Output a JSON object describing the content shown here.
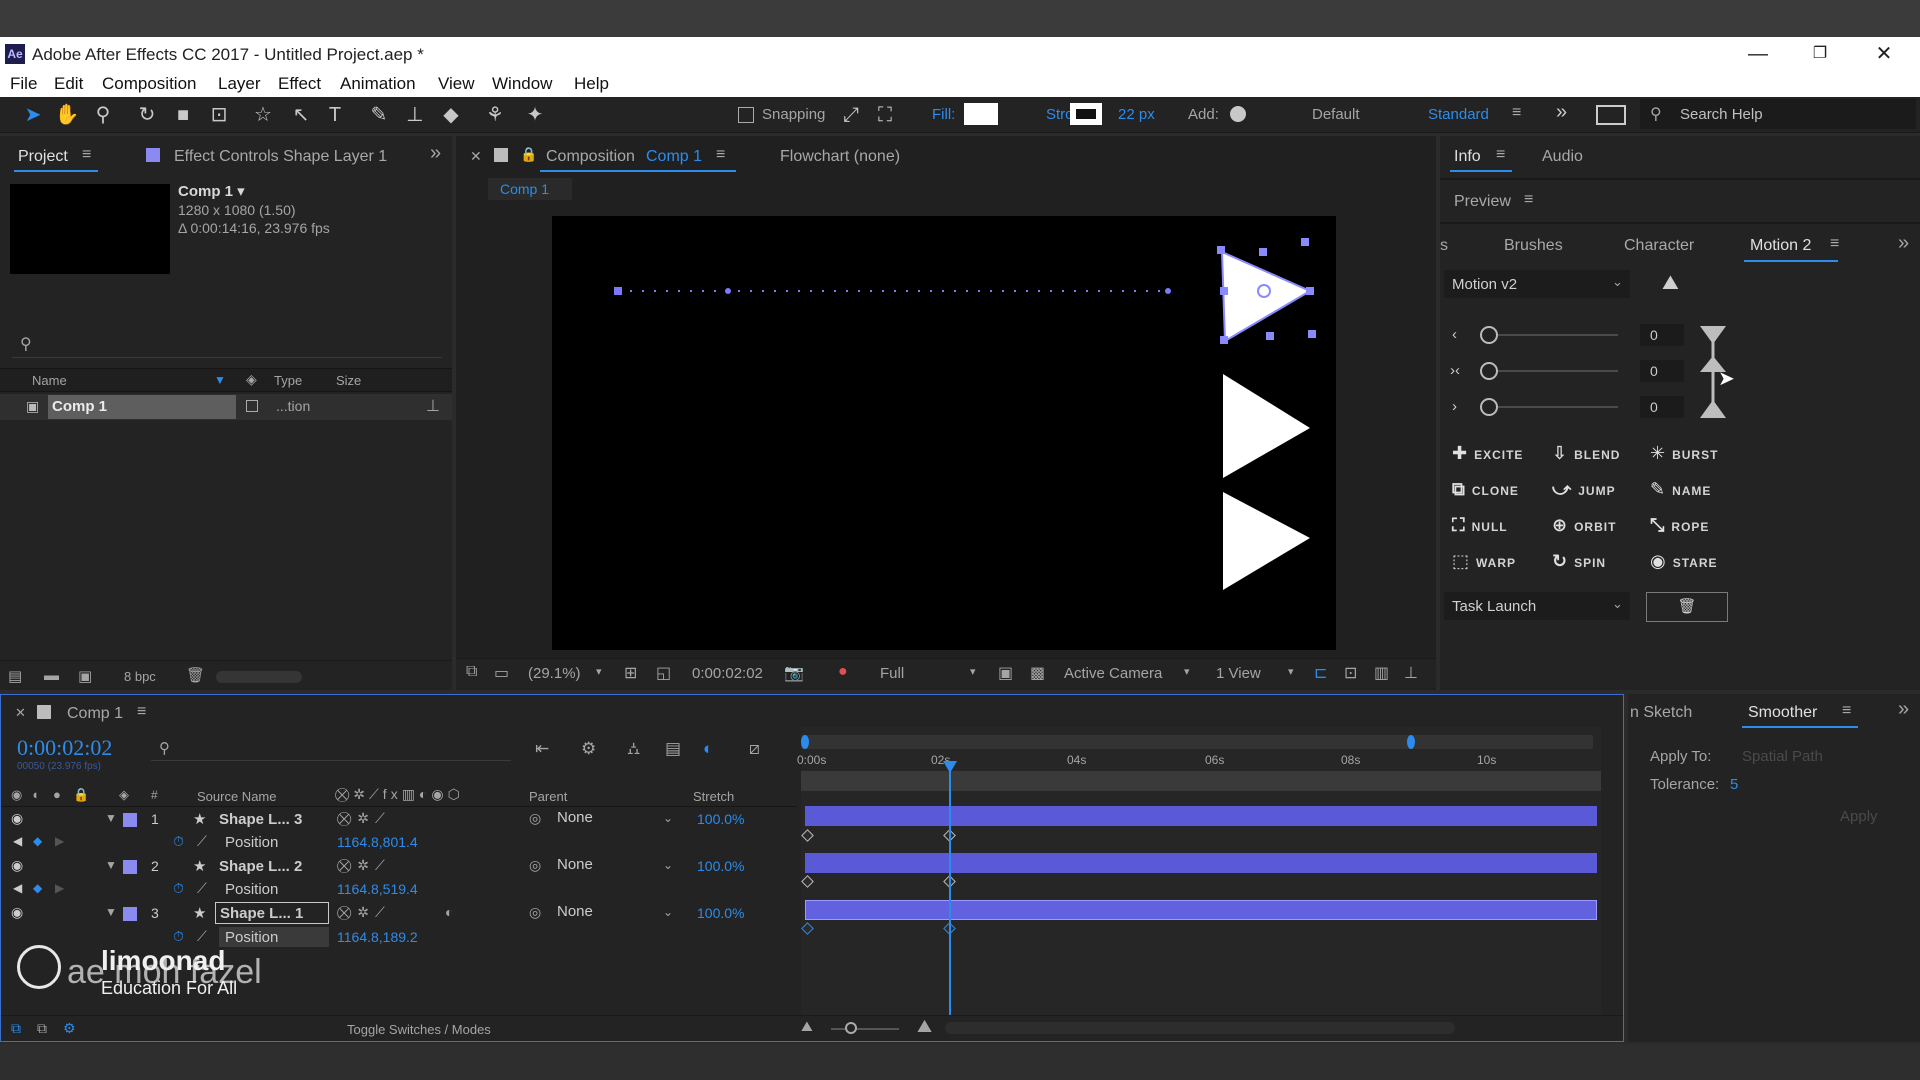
{
  "window": {
    "title": "Adobe After Effects CC 2017 - Untitled Project.aep *",
    "logo": "Ae"
  },
  "menu": [
    "File",
    "Edit",
    "Composition",
    "Layer",
    "Effect",
    "Animation",
    "View",
    "Window",
    "Help"
  ],
  "toolbar": {
    "snapping": "Snapping",
    "fill": "Fill:",
    "stroke": "Stroke:",
    "stroke_px": "22 px",
    "add": "Add:",
    "ws_default": "Default",
    "ws_standard": "Standard",
    "search": "Search Help"
  },
  "project": {
    "tab": "Project",
    "tab2": "Effect Controls Shape Layer 1",
    "comp_name": "Comp 1 ▾",
    "comp_res": "1280 x 1080 (1.50)",
    "comp_dur": "Δ 0:00:14:16, 23.976 fps",
    "col_name": "Name",
    "col_type": "Type",
    "col_size": "Size",
    "item_name": "Comp 1",
    "item_type": "...tion",
    "bpc": "8 bpc"
  },
  "comp": {
    "tab_prefix": "Composition",
    "tab_name": "Comp 1",
    "flowchart": "Flowchart (none)",
    "crumb": "Comp 1",
    "zoom": "(29.1%)",
    "time": "0:00:02:02",
    "res": "Full",
    "camera": "Active Camera",
    "views": "1 View"
  },
  "right": {
    "tab_info": "Info",
    "tab_audio": "Audio",
    "preview": "Preview",
    "tab_s": "s",
    "tab_brushes": "Brushes",
    "tab_character": "Character",
    "tab_motion": "Motion 2",
    "motion_select": "Motion v2",
    "slider_vals": [
      "0",
      "0",
      "0"
    ],
    "buttons": [
      [
        "EXCITE",
        "BLEND",
        "BURST"
      ],
      [
        "CLONE",
        "JUMP",
        "NAME"
      ],
      [
        "NULL",
        "ORBIT",
        "ROPE"
      ],
      [
        "WARP",
        "SPIN",
        "STARE"
      ]
    ],
    "task_launch": "Task Launch"
  },
  "timeline": {
    "tab": "Comp 1",
    "time": "0:00:02:02",
    "frames": "00050 (23.976 fps)",
    "col_source": "Source Name",
    "col_parent": "Parent",
    "col_stretch": "Stretch",
    "layers": [
      {
        "num": "1",
        "name": "Shape L... 3",
        "parent": "None",
        "stretch": "100.0%",
        "prop": "Position",
        "value": "1164.8,801.4"
      },
      {
        "num": "2",
        "name": "Shape L... 2",
        "parent": "None",
        "stretch": "100.0%",
        "prop": "Position",
        "value": "1164.8,519.4"
      },
      {
        "num": "3",
        "name": "Shape L... 1",
        "parent": "None",
        "stretch": "100.0%",
        "prop": "Position",
        "value": "1164.8,189.2"
      }
    ],
    "ruler": [
      "0:00s",
      "02s",
      "04s",
      "06s",
      "08s",
      "10s"
    ],
    "toggle": "Toggle Switches / Modes"
  },
  "smoother": {
    "tab_sketch": "n Sketch",
    "tab": "Smoother",
    "apply_to": "Apply To:",
    "apply_val": "Spatial Path",
    "tolerance": "Tolerance:",
    "tol_val": "5",
    "apply_btn": "Apply"
  },
  "watermark": {
    "line1": "limoonad",
    "line2": "Education For All",
    "line3": "ae moh fazel"
  },
  "colors": {
    "accent": "#2d8ceb",
    "layer_bar": "#5a5ad8",
    "label": "#8a8af0"
  }
}
